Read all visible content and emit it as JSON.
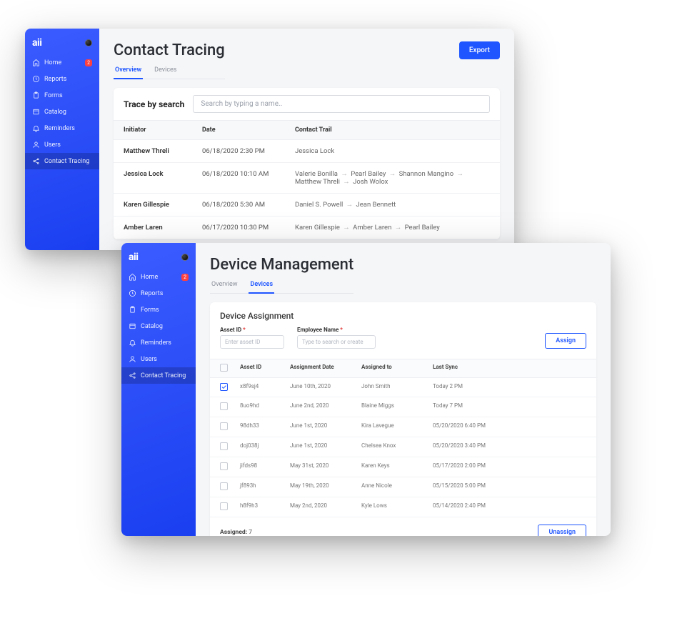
{
  "brand": "aii",
  "sidebar": {
    "items": [
      {
        "label": "Home",
        "badge": "2"
      },
      {
        "label": "Reports"
      },
      {
        "label": "Forms"
      },
      {
        "label": "Catalog"
      },
      {
        "label": "Reminders"
      },
      {
        "label": "Users"
      },
      {
        "label": "Contact Tracing"
      }
    ]
  },
  "contact_tracing": {
    "title": "Contact Tracing",
    "export_label": "Export",
    "tabs": {
      "overview": "Overview",
      "devices": "Devices"
    },
    "search_label": "Trace by search",
    "search_placeholder": "Search by typing a name..",
    "columns": {
      "initiator": "Initiator",
      "date": "Date",
      "trail": "Contact Trail"
    },
    "rows": [
      {
        "initiator": "Matthew Threli",
        "date": "06/18/2020 2:30 PM",
        "trail": [
          "Jessica Lock"
        ]
      },
      {
        "initiator": "Jessica Lock",
        "date": "06/18/2020 10:10 AM",
        "trail": [
          "Valerie Bonilla",
          "Pearl Bailey",
          "Shannon Mangino",
          "Matthew Threli",
          "Josh Wolox"
        ]
      },
      {
        "initiator": "Karen Gillespie",
        "date": "06/18/2020 5:30 AM",
        "trail": [
          "Daniel S. Powell",
          "Jean Bennett"
        ]
      },
      {
        "initiator": "Amber Laren",
        "date": "06/17/2020 10:30 PM",
        "trail": [
          "Karen Gillespie",
          "Amber Laren",
          "Pearl Bailey"
        ]
      }
    ]
  },
  "device_mgmt": {
    "title": "Device Management",
    "tabs": {
      "overview": "Overview",
      "devices": "Devices"
    },
    "section": "Device Assignment",
    "asset_id_label": "Asset ID",
    "asset_id_placeholder": "Enter asset ID",
    "employee_label": "Employee Name",
    "employee_placeholder": "Type to search or create",
    "assign_label": "Assign",
    "unassign_label": "Unassign",
    "columns": {
      "asset": "Asset ID",
      "adate": "Assignment Date",
      "assigned": "Assigned to",
      "sync": "Last Sync"
    },
    "rows": [
      {
        "checked": true,
        "asset": "x8f9sj4",
        "adate": "June 10th, 2020",
        "assigned": "John Smith",
        "sync": "Today 2 PM"
      },
      {
        "checked": false,
        "asset": "8uo9hd",
        "adate": "June 2nd, 2020",
        "assigned": "Blaine Miggs",
        "sync": "Today 7 PM"
      },
      {
        "checked": false,
        "asset": "98dh33",
        "adate": "June 1st, 2020",
        "assigned": "Kira Lavegue",
        "sync": "05/20/2020 6:40 PM"
      },
      {
        "checked": false,
        "asset": "doj038j",
        "adate": "June 1st, 2020",
        "assigned": "Chelsea Knox",
        "sync": "05/20/2020 3:40 PM"
      },
      {
        "checked": false,
        "asset": "jifds98",
        "adate": "May 31st, 2020",
        "assigned": "Karen Keys",
        "sync": "05/17/2020 2:00 PM"
      },
      {
        "checked": false,
        "asset": "jf893h",
        "adate": "May 19th, 2020",
        "assigned": "Anne Nicole",
        "sync": "05/15/2020 5:00 PM"
      },
      {
        "checked": false,
        "asset": "h8f9h3",
        "adate": "May 2nd, 2020",
        "assigned": "Kyle Lows",
        "sync": "05/14/2020 2:40 PM"
      }
    ],
    "footer_assigned_label": "Assigned:",
    "footer_assigned_count": "7"
  }
}
